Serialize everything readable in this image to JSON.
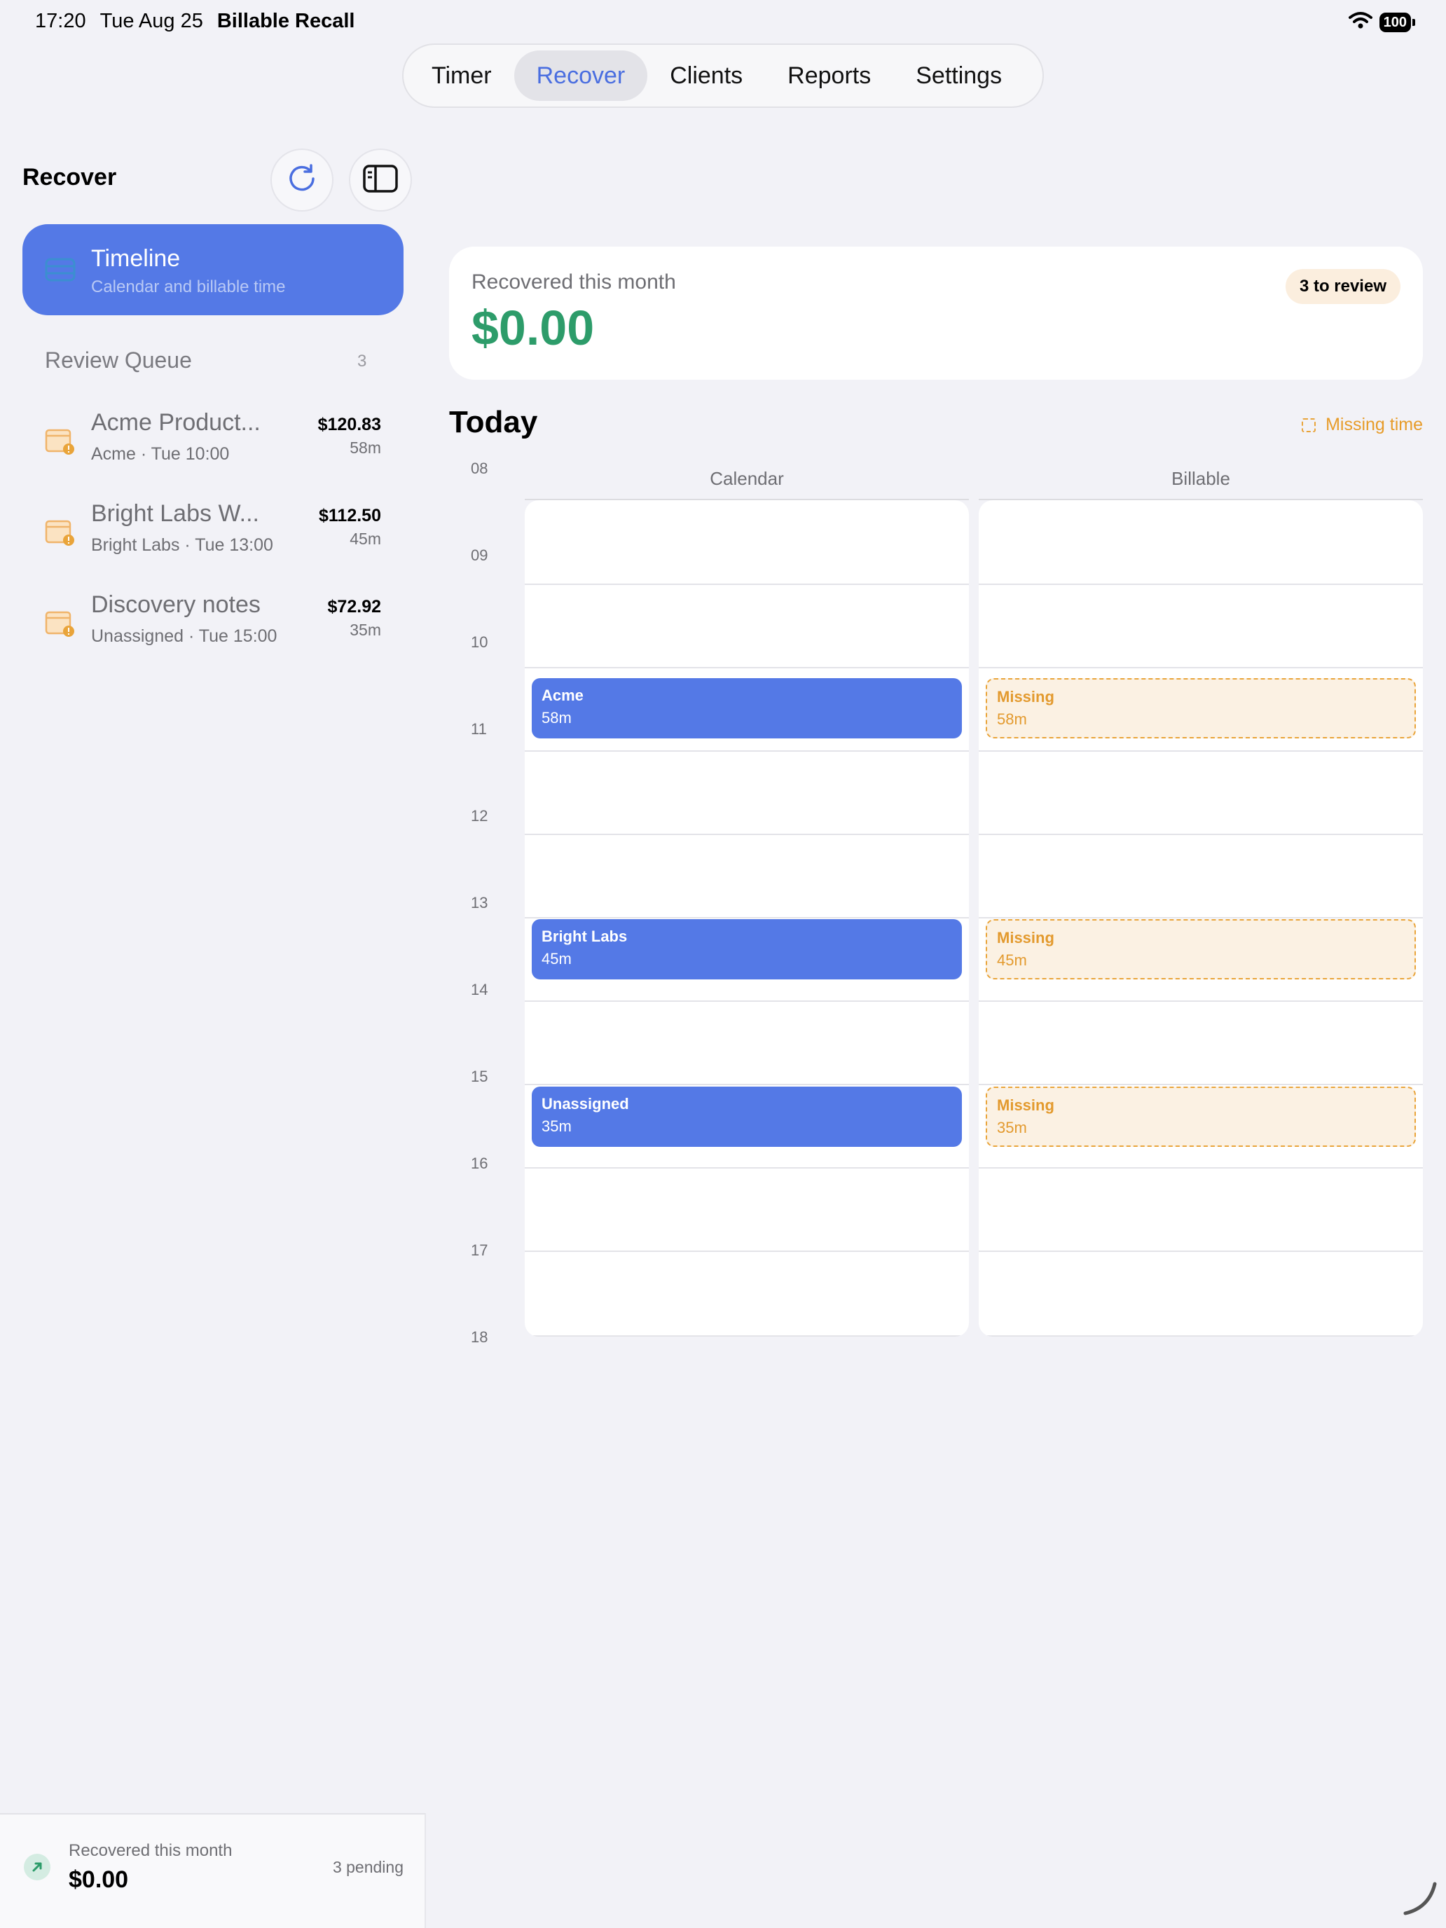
{
  "status": {
    "time": "17:20",
    "date": "Tue Aug 25",
    "app": "Billable Recall",
    "battery": "100"
  },
  "tabs": [
    "Timer",
    "Recover",
    "Clients",
    "Reports",
    "Settings"
  ],
  "sidebar": {
    "title": "Recover",
    "timeline": {
      "title": "Timeline",
      "subtitle": "Calendar and billable time"
    },
    "review_queue": {
      "title": "Review Queue",
      "count": "3",
      "items": [
        {
          "title": "Acme Product...",
          "subtitle": "Acme · Tue 10:00",
          "amount": "$120.83",
          "duration": "58m"
        },
        {
          "title": "Bright Labs W...",
          "subtitle": "Bright Labs · Tue 13:00",
          "amount": "$112.50",
          "duration": "45m"
        },
        {
          "title": "Discovery notes",
          "subtitle": "Unassigned · Tue 15:00",
          "amount": "$72.92",
          "duration": "35m"
        }
      ]
    },
    "footer": {
      "label": "Recovered this month",
      "value": "$0.00",
      "pending": "3 pending"
    }
  },
  "summary": {
    "label": "Recovered this month",
    "value": "$0.00",
    "badge": "3 to review"
  },
  "timeline": {
    "heading": "Today",
    "legend": "Missing time",
    "columns": {
      "calendar": "Calendar",
      "billable": "Billable"
    },
    "hours": [
      "08",
      "09",
      "10",
      "11",
      "12",
      "13",
      "14",
      "15",
      "16",
      "17",
      "18"
    ],
    "calendar_events": [
      {
        "title": "Acme",
        "duration": "58m"
      },
      {
        "title": "Bright Labs",
        "duration": "45m"
      },
      {
        "title": "Unassigned",
        "duration": "35m"
      }
    ],
    "billable_events": [
      {
        "title": "Missing",
        "duration": "58m"
      },
      {
        "title": "Missing",
        "duration": "45m"
      },
      {
        "title": "Missing",
        "duration": "35m"
      }
    ]
  }
}
